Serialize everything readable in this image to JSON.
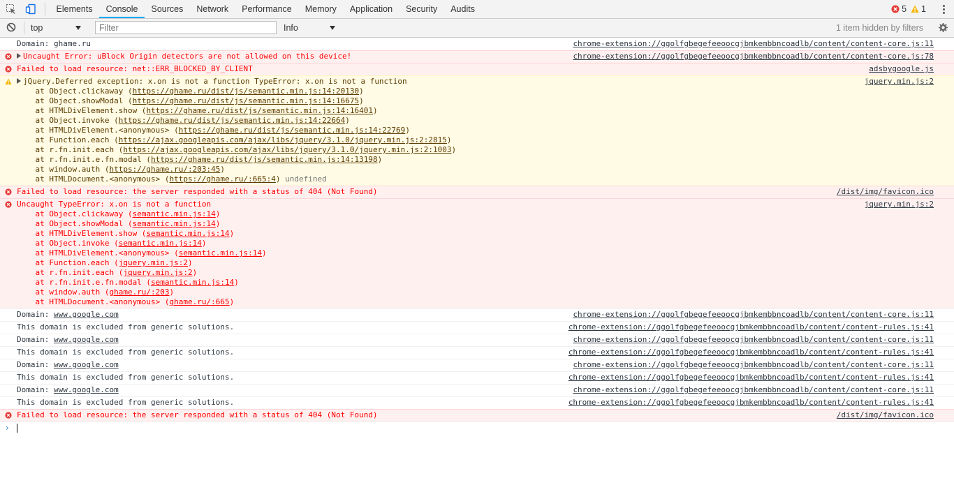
{
  "tabs": [
    "Elements",
    "Console",
    "Sources",
    "Network",
    "Performance",
    "Memory",
    "Application",
    "Security",
    "Audits"
  ],
  "active_tab": "Console",
  "counts": {
    "errors": "5",
    "warnings": "1"
  },
  "toolbar": {
    "context": "top",
    "filter_placeholder": "Filter",
    "level": "Info",
    "hidden_note": "1 item hidden by filters"
  },
  "messages": [
    {
      "type": "log",
      "text": "Domain: ghame.ru",
      "source": "chrome-extension://ggolfgbegefeeoocgjbmkembbncoadlb/content/content-core.js:11"
    },
    {
      "type": "error",
      "expand": true,
      "text": "Uncaught Error: uBlock Origin detectors are not allowed on this device!",
      "source": "chrome-extension://ggolfgbegefeeoocgjbmkembbncoadlb/content/content-core.js:78"
    },
    {
      "type": "error",
      "text": "Failed to load resource: net::ERR_BLOCKED_BY_CLIENT",
      "source": "adsbygoogle.js"
    },
    {
      "type": "warning",
      "expand": true,
      "text": "jQuery.Deferred exception: x.on is not a function TypeError: x.on is not a function",
      "source": "jquery.min.js:2",
      "stack": [
        {
          "pre": "    at Object.clickaway (",
          "link": "https://ghame.ru/dist/js/semantic.min.js:14:20130",
          "post": ")"
        },
        {
          "pre": "    at Object.showModal (",
          "link": "https://ghame.ru/dist/js/semantic.min.js:14:16675",
          "post": ")"
        },
        {
          "pre": "    at HTMLDivElement.show (",
          "link": "https://ghame.ru/dist/js/semantic.min.js:14:16401",
          "post": ")"
        },
        {
          "pre": "    at Object.invoke (",
          "link": "https://ghame.ru/dist/js/semantic.min.js:14:22664",
          "post": ")"
        },
        {
          "pre": "    at HTMLDivElement.<anonymous> (",
          "link": "https://ghame.ru/dist/js/semantic.min.js:14:22769",
          "post": ")"
        },
        {
          "pre": "    at Function.each (",
          "link": "https://ajax.googleapis.com/ajax/libs/jquery/3.1.0/jquery.min.js:2:2815",
          "post": ")"
        },
        {
          "pre": "    at r.fn.init.each (",
          "link": "https://ajax.googleapis.com/ajax/libs/jquery/3.1.0/jquery.min.js:2:1003",
          "post": ")"
        },
        {
          "pre": "    at r.fn.init.e.fn.modal (",
          "link": "https://ghame.ru/dist/js/semantic.min.js:14:13198",
          "post": ")"
        },
        {
          "pre": "    at window.auth (",
          "link": "https://ghame.ru/:203:45",
          "post": ")"
        },
        {
          "pre": "    at HTMLDocument.<anonymous> (",
          "link": "https://ghame.ru/:665:4",
          "post": ")",
          "extra": " undefined"
        }
      ]
    },
    {
      "type": "error",
      "text": "Failed to load resource: the server responded with a status of 404 (Not Found)",
      "source": "/dist/img/favicon.ico"
    },
    {
      "type": "error",
      "text": "Uncaught TypeError: x.on is not a function",
      "source": "jquery.min.js:2",
      "stack": [
        {
          "pre": "    at Object.clickaway (",
          "link": "semantic.min.js:14",
          "post": ")"
        },
        {
          "pre": "    at Object.showModal (",
          "link": "semantic.min.js:14",
          "post": ")"
        },
        {
          "pre": "    at HTMLDivElement.show (",
          "link": "semantic.min.js:14",
          "post": ")"
        },
        {
          "pre": "    at Object.invoke (",
          "link": "semantic.min.js:14",
          "post": ")"
        },
        {
          "pre": "    at HTMLDivElement.<anonymous> (",
          "link": "semantic.min.js:14",
          "post": ")"
        },
        {
          "pre": "    at Function.each (",
          "link": "jquery.min.js:2",
          "post": ")"
        },
        {
          "pre": "    at r.fn.init.each (",
          "link": "jquery.min.js:2",
          "post": ")"
        },
        {
          "pre": "    at r.fn.init.e.fn.modal (",
          "link": "semantic.min.js:14",
          "post": ")"
        },
        {
          "pre": "    at window.auth (",
          "link": "ghame.ru/:203",
          "post": ")"
        },
        {
          "pre": "    at HTMLDocument.<anonymous> (",
          "link": "ghame.ru/:665",
          "post": ")"
        }
      ]
    },
    {
      "type": "log",
      "text": "Domain: ",
      "link": "www.google.com",
      "source": "chrome-extension://ggolfgbegefeeoocgjbmkembbncoadlb/content/content-core.js:11"
    },
    {
      "type": "log",
      "text": "This domain is excluded from generic solutions.",
      "source": "chrome-extension://ggolfgbegefeeoocgjbmkembbncoadlb/content/content-rules.js:41"
    },
    {
      "type": "log",
      "text": "Domain: ",
      "link": "www.google.com",
      "source": "chrome-extension://ggolfgbegefeeoocgjbmkembbncoadlb/content/content-core.js:11"
    },
    {
      "type": "log",
      "text": "This domain is excluded from generic solutions.",
      "source": "chrome-extension://ggolfgbegefeeoocgjbmkembbncoadlb/content/content-rules.js:41"
    },
    {
      "type": "log",
      "text": "Domain: ",
      "link": "www.google.com",
      "source": "chrome-extension://ggolfgbegefeeoocgjbmkembbncoadlb/content/content-core.js:11"
    },
    {
      "type": "log",
      "text": "This domain is excluded from generic solutions.",
      "source": "chrome-extension://ggolfgbegefeeoocgjbmkembbncoadlb/content/content-rules.js:41"
    },
    {
      "type": "log",
      "text": "Domain: ",
      "link": "www.google.com",
      "source": "chrome-extension://ggolfgbegefeeoocgjbmkembbncoadlb/content/content-core.js:11"
    },
    {
      "type": "log",
      "text": "This domain is excluded from generic solutions.",
      "source": "chrome-extension://ggolfgbegefeeoocgjbmkembbncoadlb/content/content-rules.js:41"
    },
    {
      "type": "error",
      "text": "Failed to load resource: the server responded with a status of 404 (Not Found)",
      "source": "/dist/img/favicon.ico"
    }
  ],
  "colors": {
    "error_bg": "#fff0f0",
    "error_text": "#ff0000",
    "warning_bg": "#fffbe5",
    "accent": "#03a9f4"
  },
  "icons": {
    "inspect": "inspect-element-icon",
    "device": "device-toolbar-icon",
    "clear": "clear-console-icon",
    "gear": "settings-gear-icon",
    "more": "more-vertical-icon"
  }
}
